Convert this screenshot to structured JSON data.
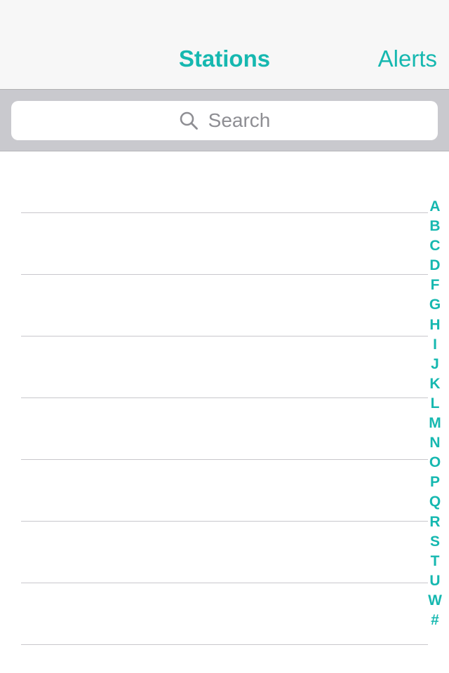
{
  "navbar": {
    "title": "Stations",
    "right_button": "Alerts",
    "accent_color": "#16b8b0"
  },
  "search": {
    "placeholder": "Search",
    "icon": "search-icon"
  },
  "list": {
    "row_count": 8
  },
  "index": {
    "letters": [
      "A",
      "B",
      "C",
      "D",
      "F",
      "G",
      "H",
      "I",
      "J",
      "K",
      "L",
      "M",
      "N",
      "O",
      "P",
      "Q",
      "R",
      "S",
      "T",
      "U",
      "W",
      "#"
    ]
  }
}
